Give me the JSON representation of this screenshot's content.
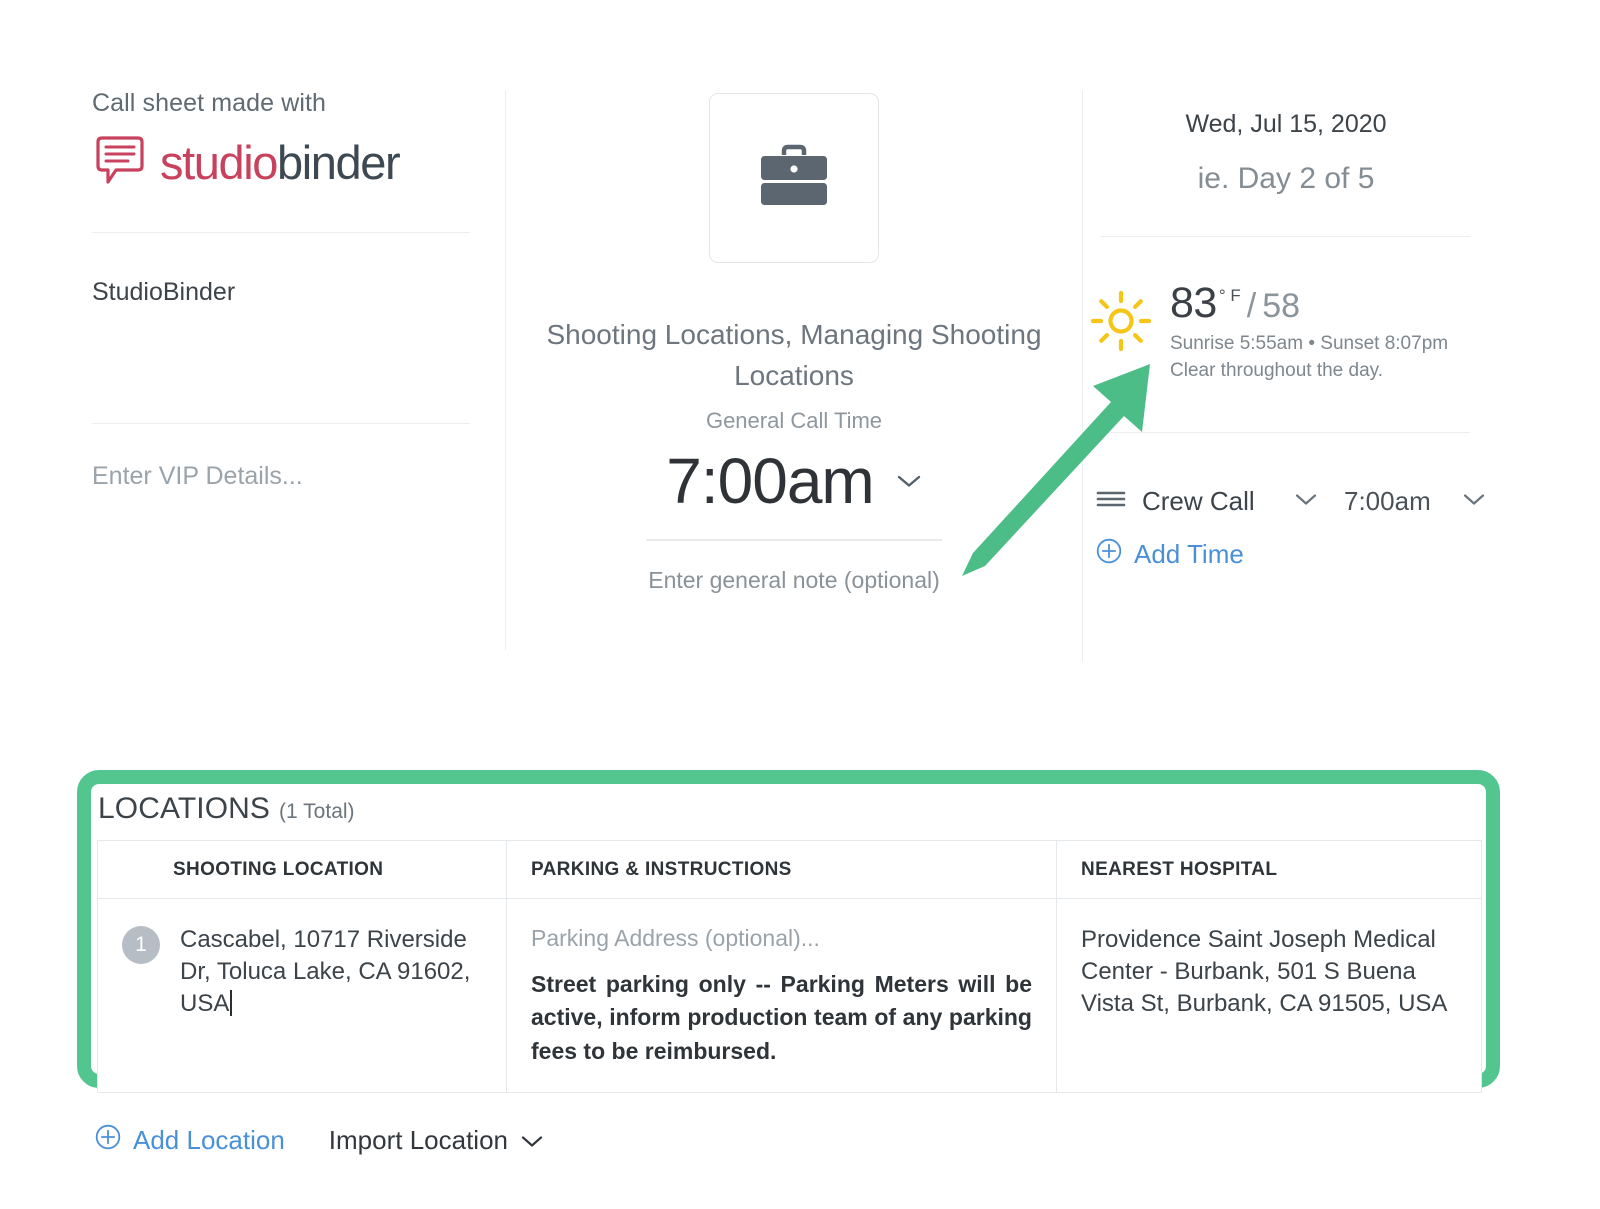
{
  "header": {
    "left": {
      "made_with_label": "Call sheet made with",
      "logo": {
        "word_1": "studio",
        "word_2": "binder",
        "mark": "speech-bubble-icon",
        "color_1": "#c8415d",
        "color_2": "#3d4852"
      },
      "company_name": "StudioBinder",
      "vip_placeholder": "Enter VIP Details..."
    },
    "center": {
      "project_icon": "briefcase-icon",
      "project_title": "Shooting Locations, Managing Shooting Locations",
      "call_time_label": "General Call Time",
      "call_time_value": "7:00am",
      "call_time_chevron": "chevron-down-icon",
      "general_note_placeholder": "Enter general note (optional)"
    },
    "right": {
      "date": "Wed, Jul 15, 2020",
      "day_of": "ie. Day 2 of 5",
      "weather": {
        "icon": "sun-icon",
        "icon_color": "#f5c518",
        "high": "83",
        "degree_unit": "° F",
        "low_separator": "/",
        "low": "58",
        "sun_times": "Sunrise 5:55am • Sunset 8:07pm",
        "description": "Clear throughout the day."
      },
      "time_row": {
        "drag_handle": "hamburger-drag-handle-icon",
        "label": "Crew Call",
        "label_chevron": "chevron-down-icon",
        "value": "7:00am",
        "value_chevron": "chevron-down-icon"
      },
      "add_time_label": "Add Time",
      "add_time_icon": "plus-circle-icon"
    }
  },
  "annotation": {
    "arrow": "green-arrow-pointing-up-right",
    "arrow_color": "#4cbd87",
    "highlight_box_color": "#52c68e"
  },
  "locations": {
    "section_title": "LOCATIONS",
    "section_count": "(1  Total)",
    "columns": [
      "SHOOTING LOCATION",
      "PARKING & INSTRUCTIONS",
      "NEAREST HOSPITAL"
    ],
    "rows": [
      {
        "number": "1",
        "shooting_location": "Cascabel, 10717 Riverside Dr, Toluca Lake, CA 91602, USA",
        "parking_placeholder": "Parking Address (optional)...",
        "parking_note": "Street parking only -- Parking Meters will be active, inform production team of any parking fees to be reimbursed.",
        "nearest_hospital": "Providence Saint Joseph Medical Center - Burbank, 501 S Buena Vista St, Burbank, CA 91505, USA"
      }
    ],
    "actions": {
      "add_location_label": "Add Location",
      "add_location_icon": "plus-circle-icon",
      "import_location_label": "Import Location",
      "import_location_icon": "chevron-down-icon"
    }
  }
}
